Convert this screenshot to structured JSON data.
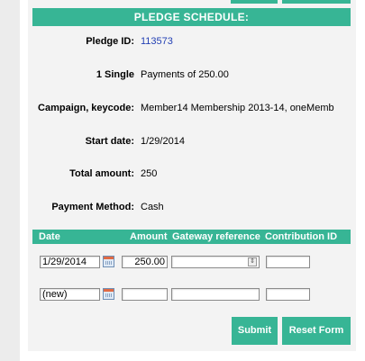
{
  "header": {
    "title": "PLEDGE SCHEDULE:"
  },
  "details": {
    "pledge_id_label": "Pledge ID:",
    "pledge_id_value": "113573",
    "payments_label": "1 Single",
    "payments_value": "Payments of 250.00",
    "campaign_label": "Campaign, keycode:",
    "campaign_value": "Member14 Membership 2013-14, oneMemb",
    "start_label": "Start date:",
    "start_value": "1/29/2014",
    "total_label": "Total amount:",
    "total_value": "250",
    "method_label": "Payment Method:",
    "method_value": "Cash"
  },
  "table": {
    "columns": [
      "Date",
      "Amount",
      "Gateway reference",
      "Contribution ID"
    ],
    "rows": [
      {
        "date": "1/29/2014",
        "amount": "250.00",
        "gateway": "",
        "contribution_id": ""
      },
      {
        "date": "(new)",
        "amount": "",
        "gateway": "",
        "contribution_id": ""
      }
    ]
  },
  "buttons": {
    "submit": "Submit",
    "reset": "Reset Form"
  },
  "icons": {
    "calendar": "calendar-icon",
    "spinner": "spinner-icon"
  },
  "colors": {
    "accent": "#37b595",
    "link": "#2340b4",
    "panel": "#f3f3f3"
  }
}
